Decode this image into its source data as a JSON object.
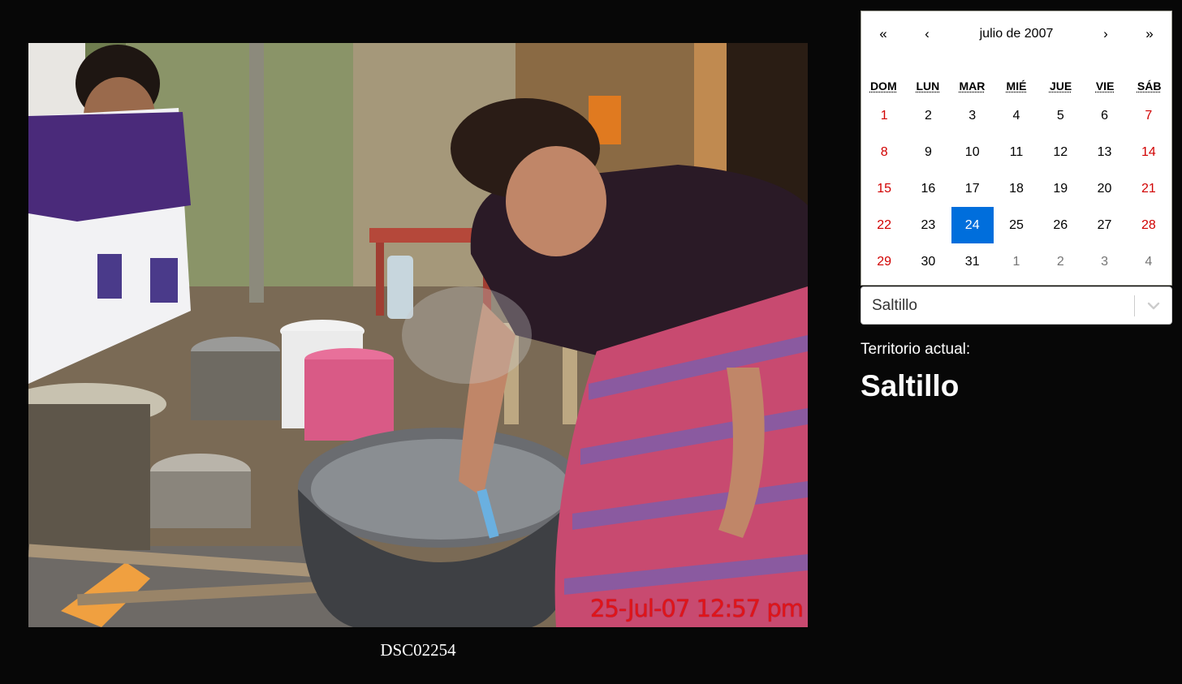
{
  "photo": {
    "timestamp_overlay": "25-Jul-07 12:57 pm",
    "caption": "DSC02254"
  },
  "calendar": {
    "nav": {
      "prev_year": "«",
      "prev_month": "‹",
      "label": "julio de 2007",
      "next_month": "›",
      "next_year": "»"
    },
    "weekdays": [
      "DOM",
      "LUN",
      "MAR",
      "MIÉ",
      "JUE",
      "VIE",
      "SÁB"
    ],
    "days": [
      {
        "d": "1",
        "t": "weekend"
      },
      {
        "d": "2",
        "t": ""
      },
      {
        "d": "3",
        "t": ""
      },
      {
        "d": "4",
        "t": ""
      },
      {
        "d": "5",
        "t": ""
      },
      {
        "d": "6",
        "t": ""
      },
      {
        "d": "7",
        "t": "weekend"
      },
      {
        "d": "8",
        "t": "weekend"
      },
      {
        "d": "9",
        "t": ""
      },
      {
        "d": "10",
        "t": ""
      },
      {
        "d": "11",
        "t": ""
      },
      {
        "d": "12",
        "t": ""
      },
      {
        "d": "13",
        "t": ""
      },
      {
        "d": "14",
        "t": "weekend"
      },
      {
        "d": "15",
        "t": "weekend"
      },
      {
        "d": "16",
        "t": ""
      },
      {
        "d": "17",
        "t": ""
      },
      {
        "d": "18",
        "t": ""
      },
      {
        "d": "19",
        "t": ""
      },
      {
        "d": "20",
        "t": ""
      },
      {
        "d": "21",
        "t": "weekend"
      },
      {
        "d": "22",
        "t": "weekend"
      },
      {
        "d": "23",
        "t": ""
      },
      {
        "d": "24",
        "t": "active"
      },
      {
        "d": "25",
        "t": ""
      },
      {
        "d": "26",
        "t": ""
      },
      {
        "d": "27",
        "t": ""
      },
      {
        "d": "28",
        "t": "weekend"
      },
      {
        "d": "29",
        "t": "weekend"
      },
      {
        "d": "30",
        "t": ""
      },
      {
        "d": "31",
        "t": ""
      },
      {
        "d": "1",
        "t": "other"
      },
      {
        "d": "2",
        "t": "other"
      },
      {
        "d": "3",
        "t": "other"
      },
      {
        "d": "4",
        "t": "other"
      }
    ],
    "colors": {
      "weekend": "#d10000",
      "other_month": "#757575",
      "active_bg": "#006edc"
    }
  },
  "territory_select": {
    "value": "Saltillo"
  },
  "territory": {
    "label": "Territorio actual:",
    "value": "Saltillo"
  }
}
